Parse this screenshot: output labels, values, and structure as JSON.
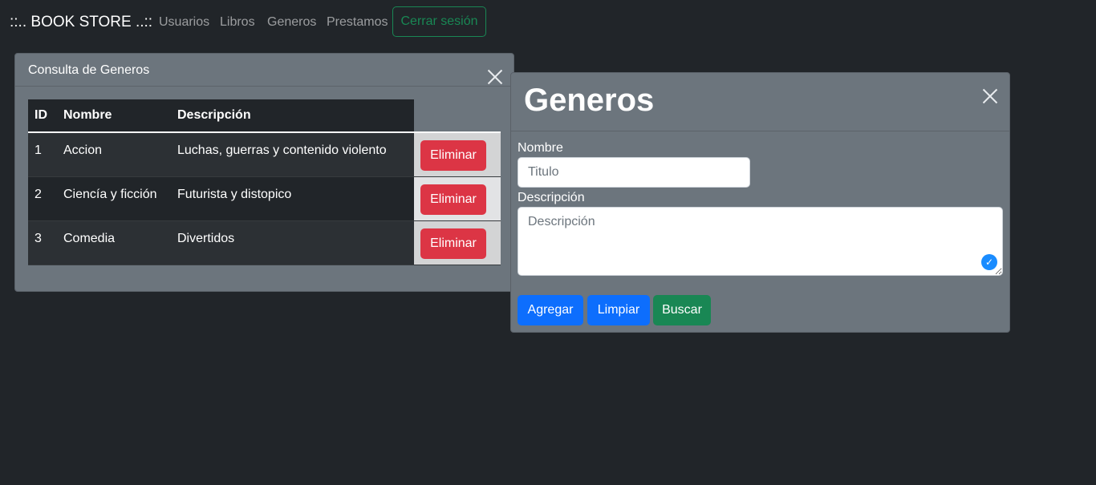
{
  "navbar": {
    "brand": "::.. BOOK STORE ..::",
    "links": [
      "Usuarios",
      "Libros",
      "Generos",
      "Prestamos"
    ],
    "logout_label": "Cerrar sesión"
  },
  "consulta": {
    "title": "Consulta de Generos",
    "columns": [
      "ID",
      "Nombre",
      "Descripción"
    ],
    "rows": [
      {
        "id": "1",
        "nombre": "Accion",
        "descripcion": "Luchas, guerras y contenido violento",
        "action": "Eliminar"
      },
      {
        "id": "2",
        "nombre": "Ciencía y ficción",
        "descripcion": "Futurista y distopico",
        "action": "Eliminar"
      },
      {
        "id": "3",
        "nombre": "Comedia",
        "descripcion": "Divertidos",
        "action": "Eliminar"
      }
    ]
  },
  "form": {
    "title": "Generos",
    "nombre_label": "Nombre",
    "nombre_placeholder": "Titulo",
    "descripcion_label": "Descripción",
    "descripcion_placeholder": "Descripción",
    "buttons": {
      "agregar": "Agregar",
      "limpiar": "Limpiar",
      "buscar": "Buscar"
    }
  },
  "colors": {
    "background": "#212529",
    "panel": "#6c757d",
    "danger": "#dc3545",
    "primary": "#0d6efd",
    "success": "#198754"
  }
}
